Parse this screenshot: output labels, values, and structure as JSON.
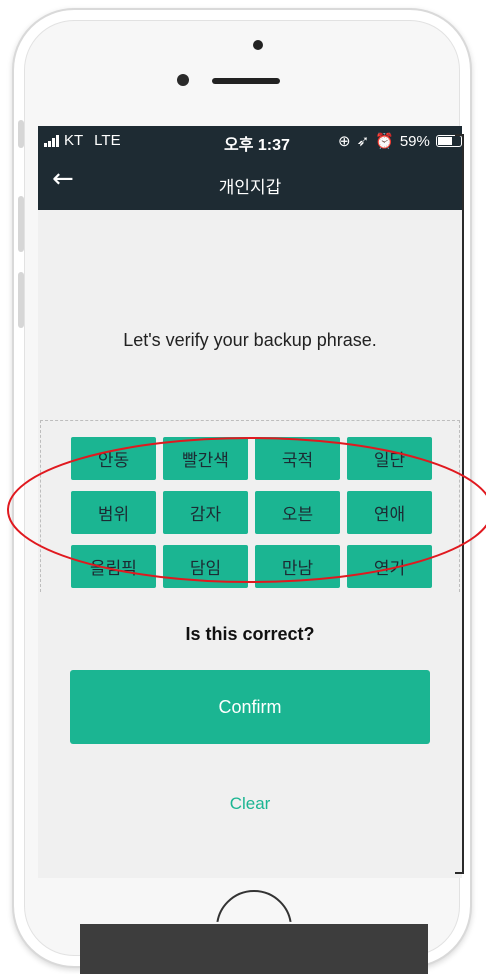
{
  "status_bar": {
    "carrier": "KT",
    "network": "LTE",
    "time": "오후 1:37",
    "battery": "59%"
  },
  "nav": {
    "title": "개인지갑"
  },
  "prompt": "Let's verify your backup phrase.",
  "words": [
    "안동",
    "빨간색",
    "국적",
    "일단",
    "범위",
    "감자",
    "오븐",
    "연애",
    "올림픽",
    "담임",
    "만남",
    "연기"
  ],
  "question": "Is this correct?",
  "confirm_label": "Confirm",
  "clear_label": "Clear",
  "colors": {
    "accent": "#1bb592",
    "header": "#1e2b33",
    "annotation": "#e0191f"
  }
}
